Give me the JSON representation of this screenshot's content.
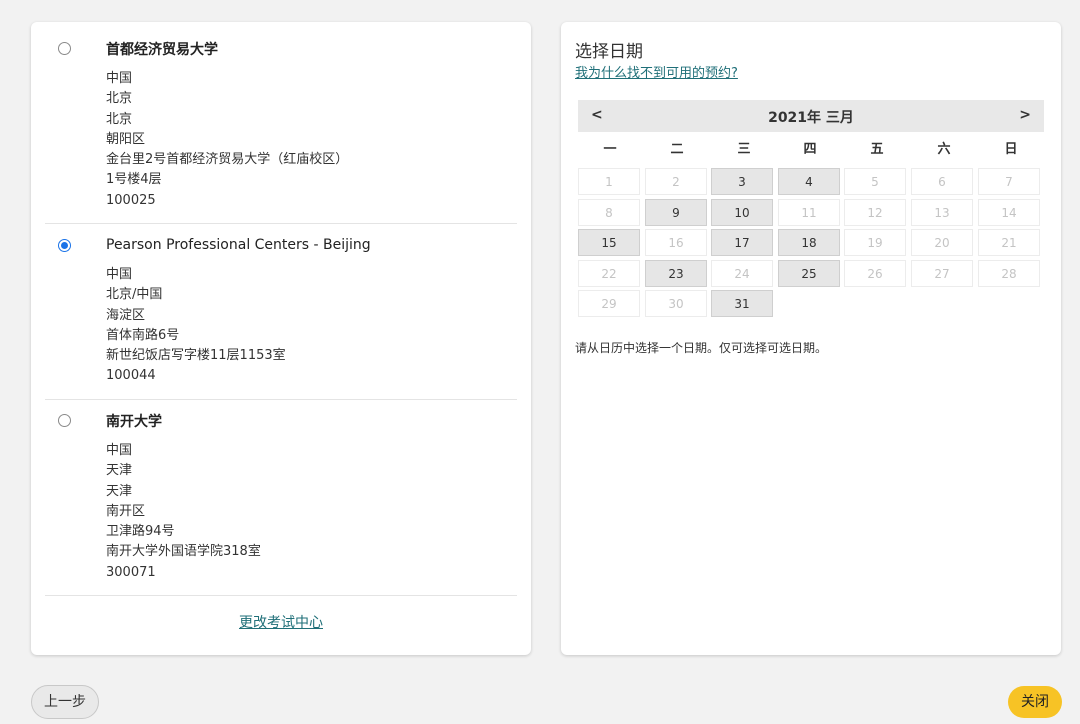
{
  "test_centers": [
    {
      "name": "首都经济贸易大学",
      "selected": false,
      "address": [
        "中国",
        "北京",
        "北京",
        "朝阳区",
        "金台里2号首都经济贸易大学（红庙校区）",
        "1号楼4层",
        "100025"
      ]
    },
    {
      "name": "Pearson Professional Centers - Beijing",
      "selected": true,
      "address": [
        "中国",
        "北京/中国",
        "海淀区",
        "首体南路6号",
        "新世纪饭店写字楼11层1153室",
        "100044"
      ]
    },
    {
      "name": "南开大学",
      "selected": false,
      "address": [
        "中国",
        "天津",
        "天津",
        "南开区",
        "卫津路94号",
        "南开大学外国语学院318室",
        "300071"
      ]
    }
  ],
  "change_center_link": "更改考试中心",
  "date_panel": {
    "title": "选择日期",
    "why_link": "我为什么找不到可用的预约?",
    "calendar": {
      "prev": "<",
      "next": ">",
      "month_label": "2021年 三月",
      "weekdays": [
        "一",
        "二",
        "三",
        "四",
        "五",
        "六",
        "日"
      ],
      "days": [
        {
          "day": "1",
          "available": false
        },
        {
          "day": "2",
          "available": false
        },
        {
          "day": "3",
          "available": true
        },
        {
          "day": "4",
          "available": true
        },
        {
          "day": "5",
          "available": false
        },
        {
          "day": "6",
          "available": false
        },
        {
          "day": "7",
          "available": false
        },
        {
          "day": "8",
          "available": false
        },
        {
          "day": "9",
          "available": true
        },
        {
          "day": "10",
          "available": true
        },
        {
          "day": "11",
          "available": false
        },
        {
          "day": "12",
          "available": false
        },
        {
          "day": "13",
          "available": false
        },
        {
          "day": "14",
          "available": false
        },
        {
          "day": "15",
          "available": true
        },
        {
          "day": "16",
          "available": false
        },
        {
          "day": "17",
          "available": true
        },
        {
          "day": "18",
          "available": true
        },
        {
          "day": "19",
          "available": false
        },
        {
          "day": "20",
          "available": false
        },
        {
          "day": "21",
          "available": false
        },
        {
          "day": "22",
          "available": false
        },
        {
          "day": "23",
          "available": true
        },
        {
          "day": "24",
          "available": false
        },
        {
          "day": "25",
          "available": true
        },
        {
          "day": "26",
          "available": false
        },
        {
          "day": "27",
          "available": false
        },
        {
          "day": "28",
          "available": false
        },
        {
          "day": "29",
          "available": false
        },
        {
          "day": "30",
          "available": false
        },
        {
          "day": "31",
          "available": true
        }
      ]
    },
    "hint": "请从日历中选择一个日期。仅可选择可选日期。"
  },
  "footer": {
    "prev_label": "上一步",
    "close_label": "关闭"
  },
  "colors": {
    "accent_link": "#1f6f78",
    "close_button": "#f7c325",
    "radio_selected": "#1a73e8"
  }
}
